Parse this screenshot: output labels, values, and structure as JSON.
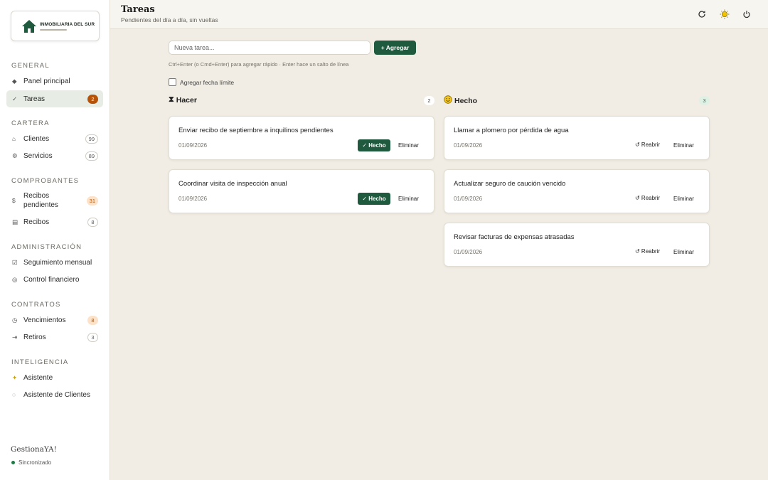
{
  "sidebar": {
    "logo": {
      "title": "INMOBILIARIA DEL SUR"
    },
    "sections": {
      "general": "GENERAL",
      "cartera": "CARTERA",
      "comprobantes": "COMPROBANTES",
      "administracion": "ADMINISTRACIÓN",
      "contratos": "CONTRATOS",
      "inteligencia": "INTELIGENCIA"
    },
    "items": {
      "panel": {
        "label": "Panel principal",
        "icon": "diamond-icon"
      },
      "tareas": {
        "label": "Tareas",
        "icon": "check-icon",
        "badge": "2"
      },
      "clientes": {
        "label": "Clientes",
        "icon": "home-icon",
        "badge": "99"
      },
      "servicios": {
        "label": "Servicios",
        "icon": "gear-icon",
        "badge": "89"
      },
      "recibos_pendientes": {
        "label": "Recibos pendientes",
        "icon": "dollar-icon",
        "badge": "31"
      },
      "recibos": {
        "label": "Recibos",
        "icon": "receipt-icon",
        "badge": "8"
      },
      "seguimiento": {
        "label": "Seguimiento mensual",
        "icon": "checklist-icon"
      },
      "control": {
        "label": "Control financiero",
        "icon": "coin-icon"
      },
      "vencimientos": {
        "label": "Vencimientos",
        "icon": "clock-icon",
        "badge": "8"
      },
      "retiros": {
        "label": "Retiros",
        "icon": "exit-icon",
        "badge": "3"
      },
      "asistente": {
        "label": "Asistente",
        "icon": "sparkle-icon"
      },
      "asistente_clientes": {
        "label": "Asistente de Clientes",
        "icon": "chat-icon"
      }
    },
    "brand": "GestionaYA!",
    "sync_status": "Sincronizado"
  },
  "header": {
    "title": "Tareas",
    "subtitle": "Pendientes del día a día, sin vueltas"
  },
  "composer": {
    "placeholder": "Nueva tarea...",
    "add_label": "+ Agregar",
    "hint": "Ctrl+Enter (o Cmd+Enter) para agregar rápido · Enter hace un salto de línea",
    "deadline_label": "Agregar fecha límite"
  },
  "columns": {
    "todo": {
      "title": "Hacer",
      "count": "2",
      "done_label": "✓ Hecho",
      "delete_label": "Eliminar",
      "tasks": [
        {
          "title": "Enviar recibo de septiembre a inquilinos pendientes",
          "date": "01/09/2026"
        },
        {
          "title": "Coordinar visita de inspección anual",
          "date": "01/09/2026"
        }
      ]
    },
    "done": {
      "title": "Hecho",
      "count": "3",
      "reopen_label": "↺ Reabrir",
      "delete_label": "Eliminar",
      "tasks": [
        {
          "title": "Llamar a plomero por pérdida de agua",
          "date": "01/09/2026"
        },
        {
          "title": "Actualizar seguro de caución vencido",
          "date": "01/09/2026"
        },
        {
          "title": "Revisar facturas de expensas atrasadas",
          "date": "01/09/2026"
        }
      ]
    }
  },
  "colors": {
    "accent": "#1f5a3e",
    "badge_orange": "#b45309",
    "background": "#f1ede4"
  }
}
